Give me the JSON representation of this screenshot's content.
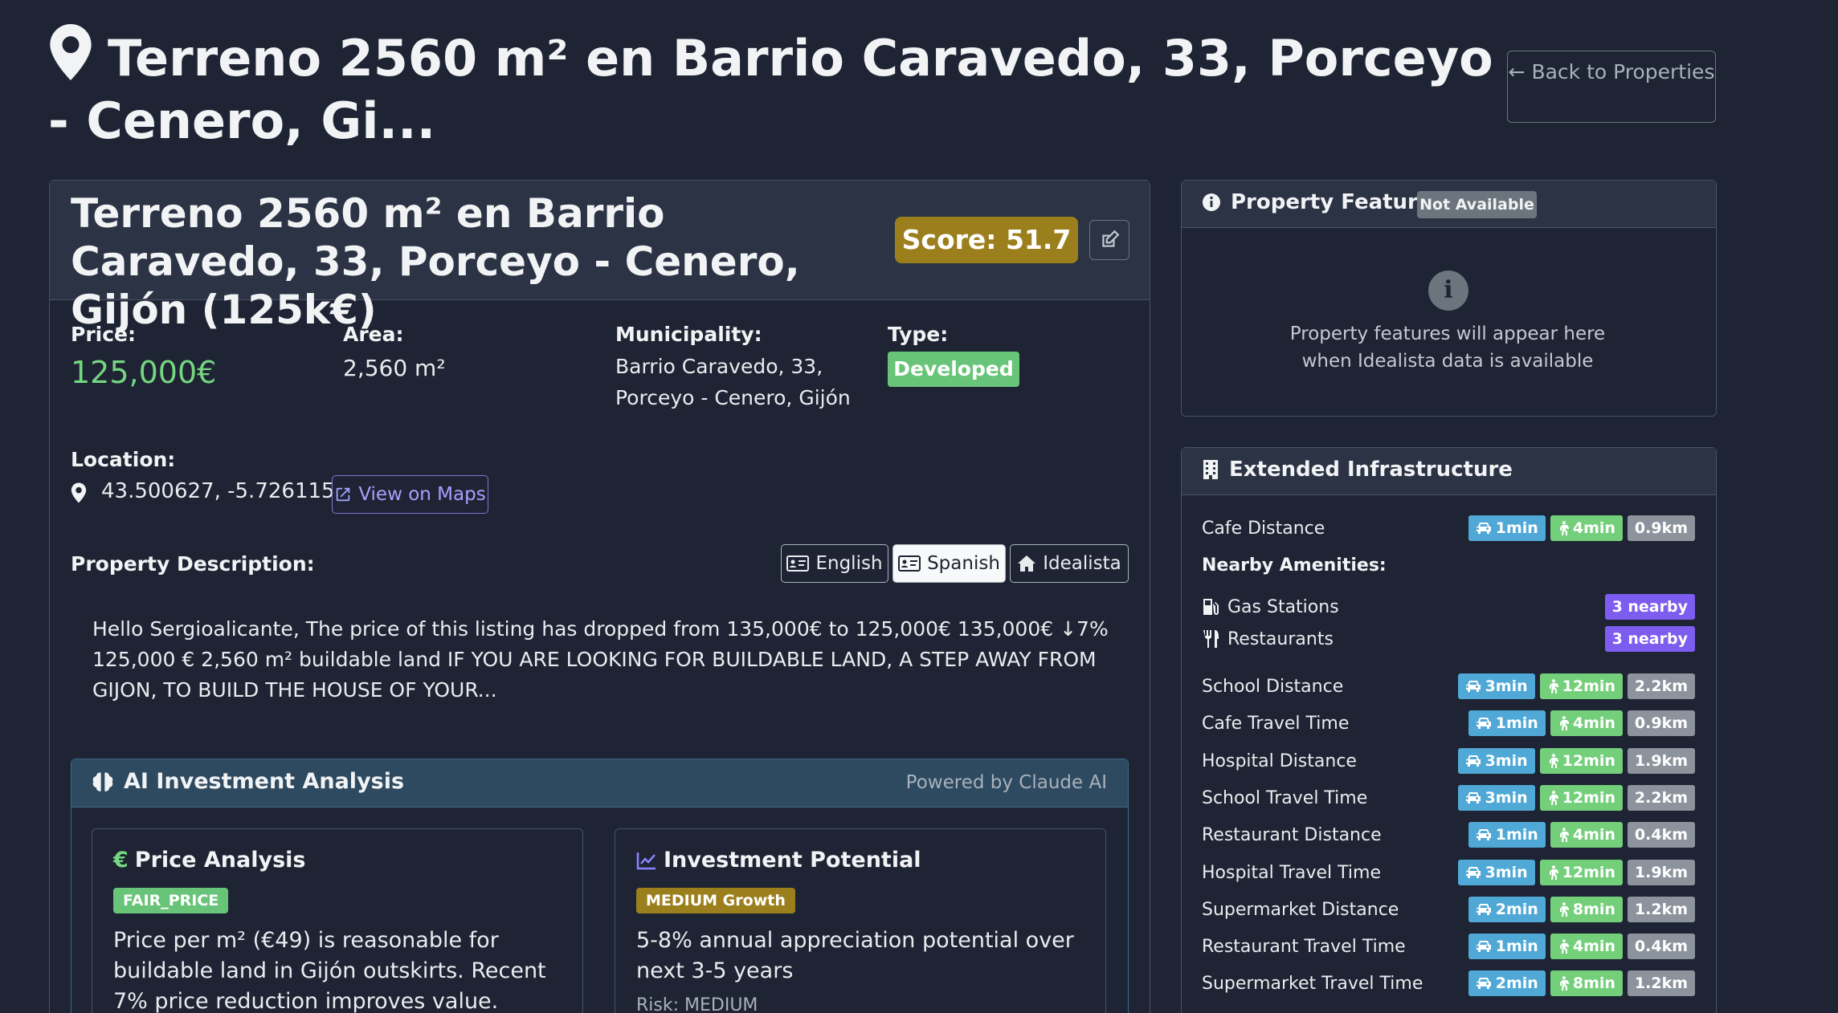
{
  "header": {
    "title": "Terreno 2560 m² en Barrio Caravedo, 33, Porceyo - Cenero, Gi...",
    "back_label": "Back to Properties"
  },
  "property": {
    "title": "Terreno 2560 m² en Barrio Caravedo, 33, Porceyo - Cenero, Gijón (125k€)",
    "score": "Score: 51.7",
    "price_label": "Price:",
    "price": "125,000€",
    "area_label": "Area:",
    "area": "2,560 m²",
    "municipality_label": "Municipality:",
    "municipality_line1": "Barrio Caravedo, 33,",
    "municipality_line2": "Porceyo - Cenero, Gijón",
    "type_label": "Type:",
    "type": "Developed",
    "location_label": "Location:",
    "coordinates": "43.500627, -5.726115",
    "maps_label": "View on Maps",
    "description_label": "Property Description:",
    "lang_buttons": [
      "English",
      "Spanish",
      "Idealista"
    ],
    "active_lang": "Spanish",
    "description": "Hello Sergioalicante, The price of this listing has dropped from 135,000€ to 125,000€ 135,000€ ↓7% 125,000 € 2,560 m² buildable land IF YOU ARE LOOKING FOR BUILDABLE LAND, A STEP AWAY FROM GIJON, TO BUILD THE HOUSE OF YOUR..."
  },
  "ai_analysis": {
    "title": "AI Investment Analysis",
    "powered_by": "Powered by Claude AI",
    "price_analysis": {
      "title": "Price Analysis",
      "tag": "FAIR_PRICE",
      "text": "Price per m² (€49) is reasonable for buildable land in Gijón outskirts. Recent 7% price reduction improves value."
    },
    "investment_potential": {
      "title": "Investment Potential",
      "tag": "MEDIUM Growth",
      "text": "5-8% annual appreciation potential over next 3-5 years",
      "risk": "Risk: MEDIUM"
    }
  },
  "features": {
    "title": "Property Features",
    "badge": "Not Available",
    "message_line1": "Property features will appear here",
    "message_line2": "when Idealista data is available"
  },
  "infrastructure": {
    "title": "Extended Infrastructure",
    "cafe": {
      "label": "Cafe Distance",
      "car": "1min",
      "walk": "4min",
      "dist": "0.9km"
    },
    "amenities_label": "Nearby Amenities:",
    "amenities": [
      {
        "label": "Gas Stations",
        "count": "3 nearby"
      },
      {
        "label": "Restaurants",
        "count": "3 nearby"
      }
    ],
    "rows": [
      {
        "label": "School Distance",
        "car": "3min",
        "walk": "12min",
        "dist": "2.2km"
      },
      {
        "label": "Cafe Travel Time",
        "car": "1min",
        "walk": "4min",
        "dist": "0.9km"
      },
      {
        "label": "Hospital Distance",
        "car": "3min",
        "walk": "12min",
        "dist": "1.9km"
      },
      {
        "label": "School Travel Time",
        "car": "3min",
        "walk": "12min",
        "dist": "2.2km"
      },
      {
        "label": "Restaurant Distance",
        "car": "1min",
        "walk": "4min",
        "dist": "0.4km"
      },
      {
        "label": "Hospital Travel Time",
        "car": "3min",
        "walk": "12min",
        "dist": "1.9km"
      },
      {
        "label": "Supermarket Distance",
        "car": "2min",
        "walk": "8min",
        "dist": "1.2km"
      },
      {
        "label": "Restaurant Travel Time",
        "car": "1min",
        "walk": "4min",
        "dist": "0.4km"
      },
      {
        "label": "Supermarket Travel Time",
        "car": "2min",
        "walk": "8min",
        "dist": "1.2km"
      }
    ]
  },
  "colors": {
    "background": "#1e2433",
    "price_green": "#75d681",
    "score_gold": "#9c7f1d",
    "car_blue": "#4fa8d6",
    "walk_green": "#74cf7b",
    "nearby_purple": "#7d5cf0"
  }
}
